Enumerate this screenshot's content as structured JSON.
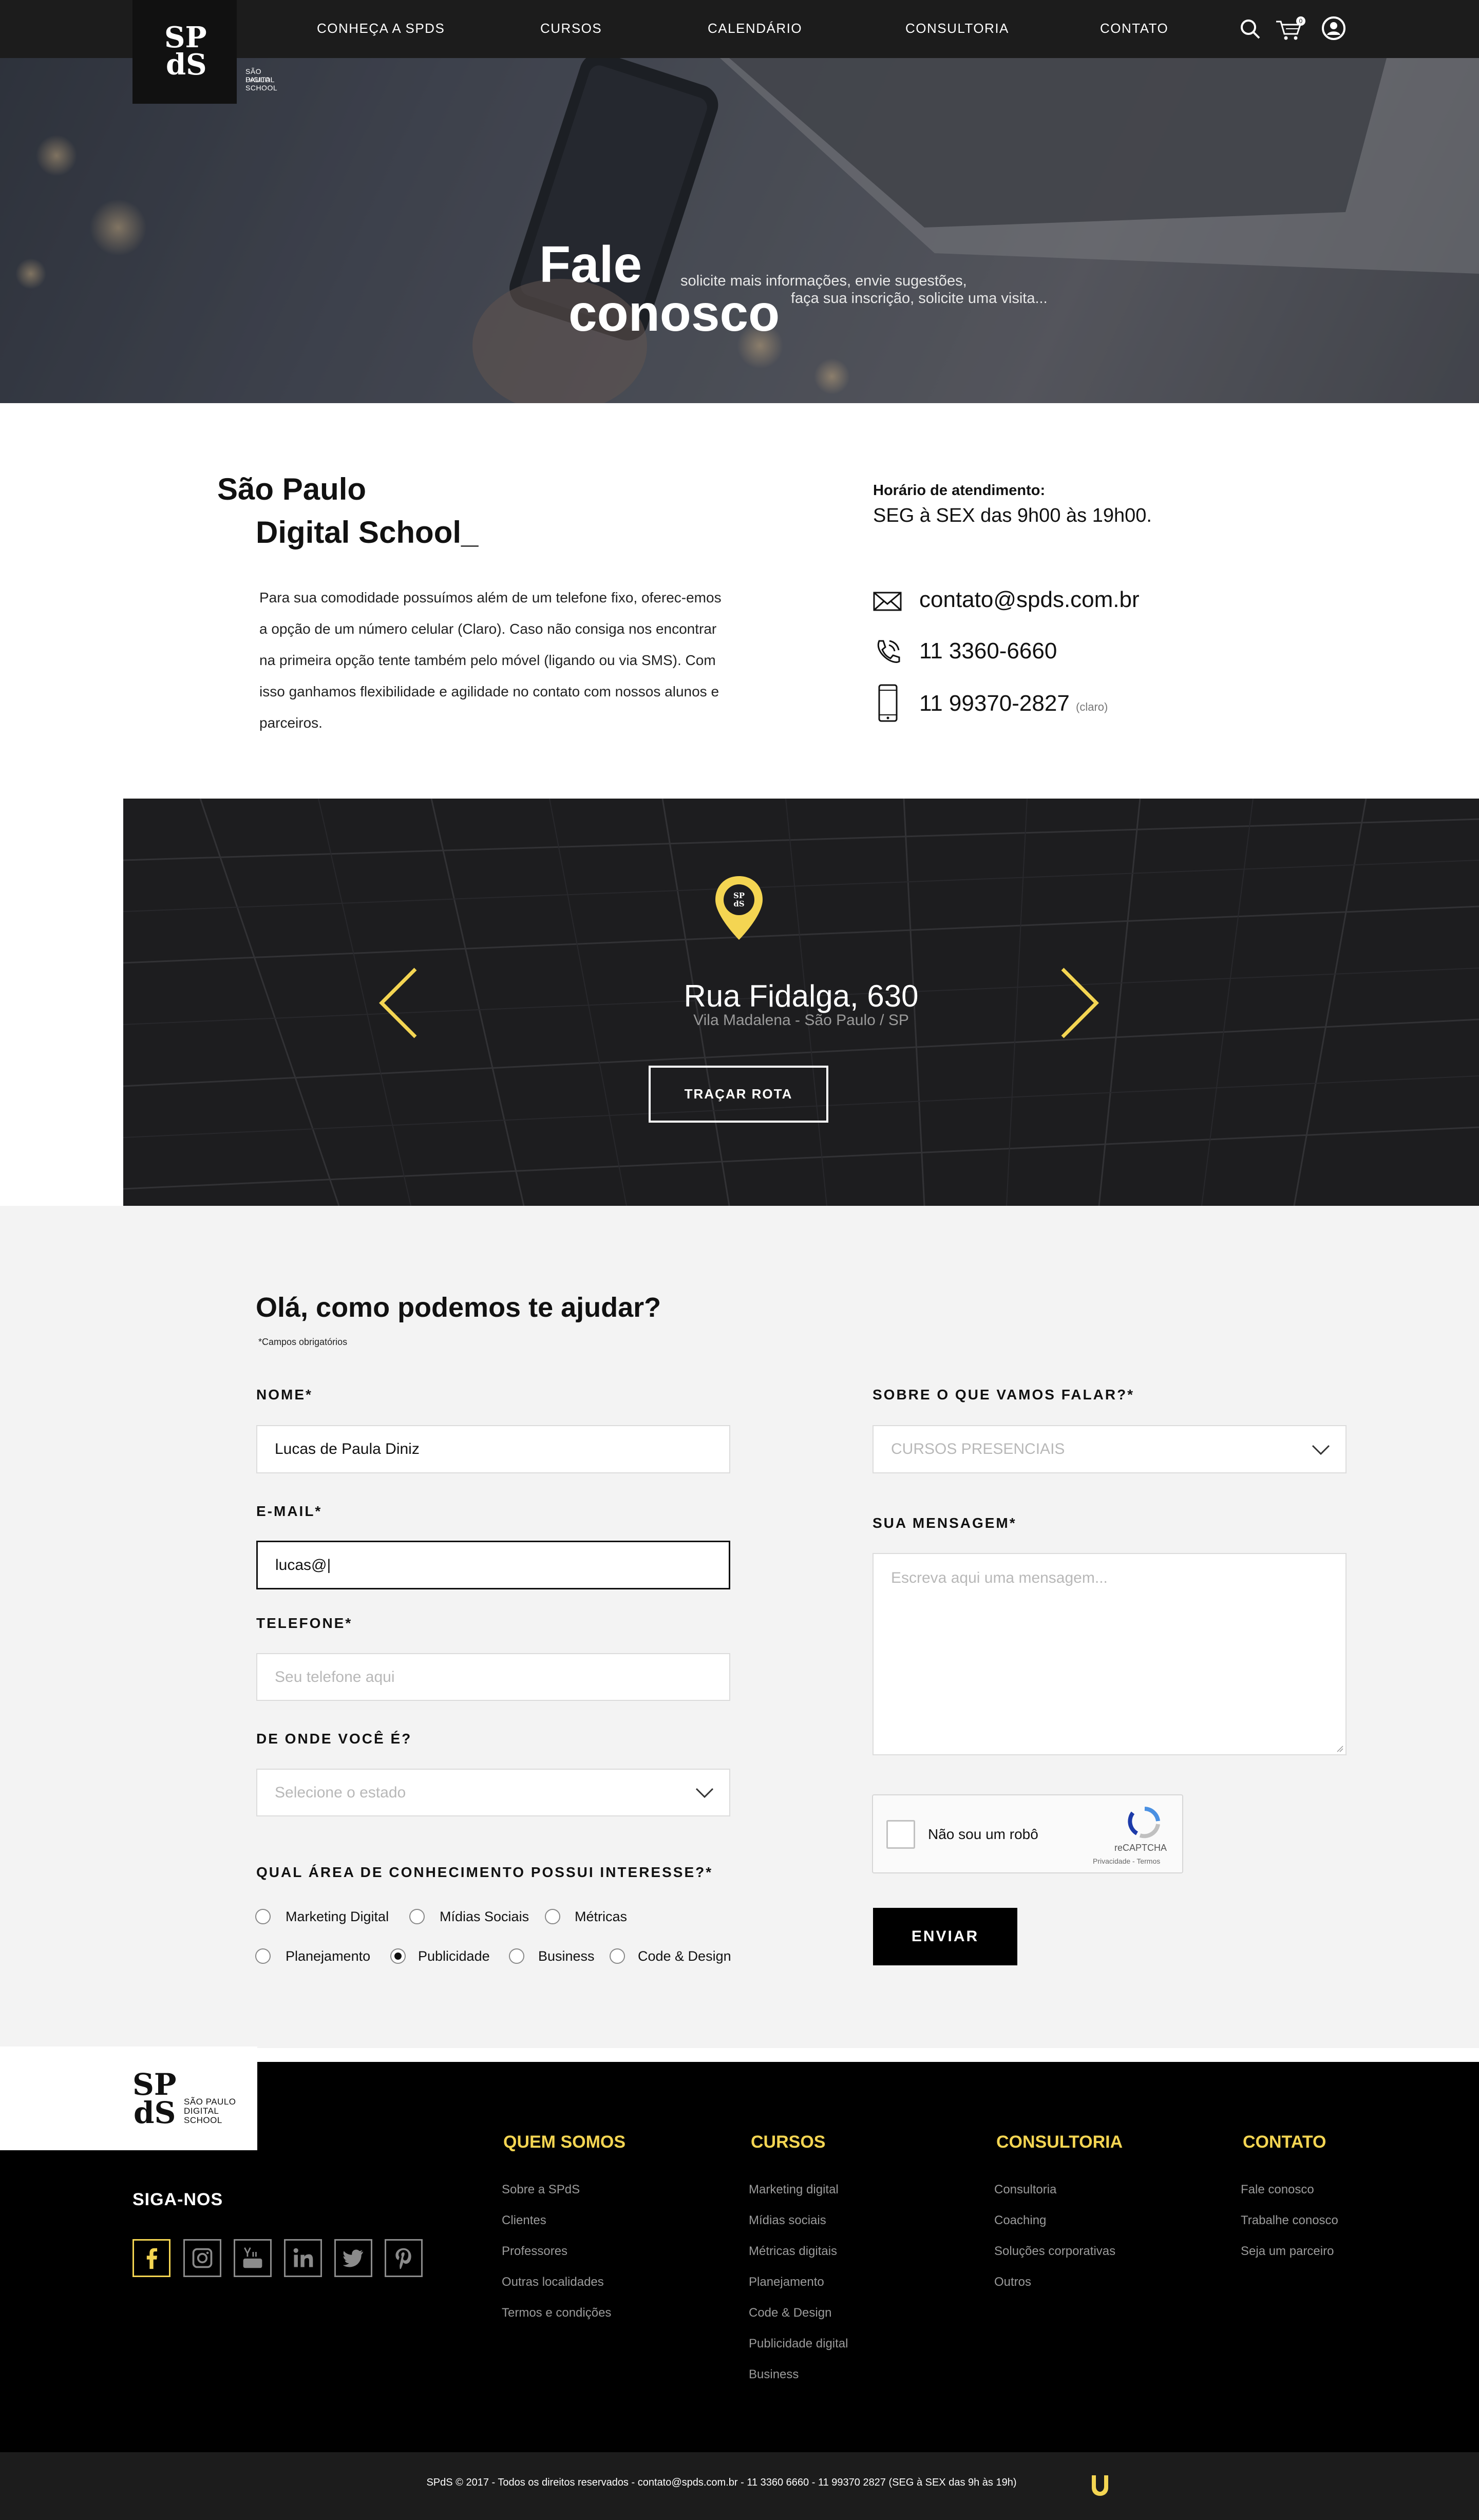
{
  "colors": {
    "accent_yellow": "#f4d552",
    "nav_bg": "#1c1c1c",
    "footer_bg": "#000000",
    "form_bg": "#f3f3f3"
  },
  "logo": {
    "mark_top": "SP",
    "mark_bottom": "dS",
    "sub_1": "SÃO PAULO",
    "sub_2": "DIGITAL",
    "sub_3": "SCHOOL"
  },
  "nav": {
    "items": [
      {
        "label": "CONHEÇA A SPDS"
      },
      {
        "label": "CURSOS"
      },
      {
        "label": "CALENDÁRIO"
      },
      {
        "label": "CONSULTORIA"
      },
      {
        "label": "CONTATO"
      }
    ],
    "icons": [
      "search-icon",
      "cart-icon",
      "user-icon"
    ],
    "cart_count": "0"
  },
  "hero": {
    "title_1": "Fale",
    "title_2": "conosco",
    "sub_1": "solicite mais informações, envie sugestões,",
    "sub_2": "faça sua inscrição, solicite uma visita..."
  },
  "about": {
    "title_1": "São Paulo",
    "title_2": "Digital School_",
    "text": "Para sua comodidade possuímos além de um telefone fixo, oferec-emos a opção de um número celular (Claro). Caso não consiga nos encontrar na primeira opção tente também pelo móvel (ligando ou via SMS). Com isso ganhamos flexibilidade e agilidade no contato com nossos alunos e parceiros.",
    "hours_label": "Horário de atendimento:",
    "hours_value": "SEG à SEX das 9h00 às 19h00.",
    "email": "contato@spds.com.br",
    "phone": "11 3360-6660",
    "mobile": "11 99370-2827",
    "mobile_note": "(claro)"
  },
  "map": {
    "street": "Rua Fidalga, 630",
    "area": "Vila Madalena - São Paulo / SP",
    "route_button": "TRAÇAR ROTA",
    "pin_label_top": "SP",
    "pin_label_bottom": "dS"
  },
  "form": {
    "title": "Olá, como podemos te ajudar?",
    "required_note": "*Campos obrigatórios",
    "name_label": "NOME*",
    "name_value": "Lucas de Paula Diniz",
    "email_label": "E-MAIL*",
    "email_value": "lucas@|",
    "phone_label": "TELEFONE*",
    "phone_placeholder": "Seu telefone aqui",
    "state_label": "DE ONDE VOCÊ É?",
    "state_placeholder": "Selecione o estado",
    "area_label": "QUAL ÁREA DE CONHECIMENTO POSSUI INTERESSE?*",
    "areas": [
      {
        "label": "Marketing Digital",
        "selected": false
      },
      {
        "label": "Mídias Sociais",
        "selected": false
      },
      {
        "label": "Métricas",
        "selected": false
      },
      {
        "label": "Planejamento",
        "selected": false
      },
      {
        "label": "Publicidade",
        "selected": true
      },
      {
        "label": "Business",
        "selected": false
      },
      {
        "label": "Code & Design",
        "selected": false
      }
    ],
    "topic_label": "SOBRE O QUE VAMOS FALAR?*",
    "topic_value": "CURSOS PRESENCIAIS",
    "message_label": "SUA MENSAGEM*",
    "message_placeholder": "Escreva aqui uma mensagem...",
    "captcha_label": "Não sou um robô",
    "captcha_brand": "reCAPTCHA",
    "captcha_terms": "Privacidade - Termos",
    "submit": "ENVIAR"
  },
  "footer": {
    "follow": "SIGA-NOS",
    "socials": [
      "facebook-icon",
      "instagram-icon",
      "youtube-icon",
      "linkedin-icon",
      "twitter-icon",
      "pinterest-icon"
    ],
    "columns": [
      {
        "heading": "QUEM SOMOS",
        "links": [
          "Sobre a SPdS",
          "Clientes",
          "Professores",
          "Outras localidades",
          "Termos e condições"
        ]
      },
      {
        "heading": "CURSOS",
        "links": [
          "Marketing digital",
          "Mídias sociais",
          "Métricas digitais",
          "Planejamento",
          "Code & Design",
          "Publicidade digital",
          "Business"
        ]
      },
      {
        "heading": "CONSULTORIA",
        "links": [
          "Consultoria",
          "Coaching",
          "Soluções corporativas",
          "Outros"
        ]
      },
      {
        "heading": "CONTATO",
        "links": [
          "Fale conosco",
          "Trabalhe conosco",
          "Seja um parceiro"
        ]
      }
    ],
    "copyright": "SPdS © 2017 - Todos os direitos reservados - contato@spds.com.br - 11 3360 6660 - 11 99370 2827 (SEG à SEX das 9h às 19h)"
  }
}
